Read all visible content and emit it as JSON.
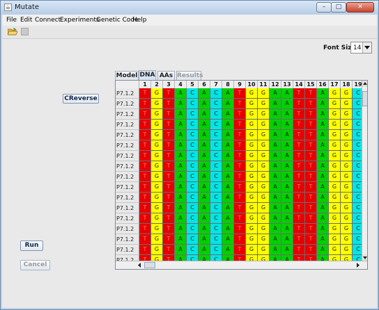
{
  "window": {
    "title": "Mutate",
    "minimize": "–",
    "maximize": "□",
    "close": "✕"
  },
  "menu": [
    "File",
    "Edit",
    "Connect",
    "Experiments",
    "Genetic Code",
    "Help"
  ],
  "toolbar": {
    "open_icon": "folder-open-icon",
    "save_icon": "save-icon"
  },
  "font_size": {
    "label": "Font Size:",
    "value": "14"
  },
  "buttons": {
    "reverse": "CReverse",
    "run": "Run",
    "cancel": "Cancel"
  },
  "tabs": [
    {
      "label": "Model",
      "active": false,
      "enabled": true
    },
    {
      "label": "DNA",
      "active": true,
      "enabled": true
    },
    {
      "label": "AAs",
      "active": false,
      "enabled": true
    },
    {
      "label": "Results",
      "active": false,
      "enabled": false
    }
  ],
  "table": {
    "columns": [
      "1",
      "2",
      "3",
      "4",
      "5",
      "6",
      "7",
      "8",
      "9",
      "10",
      "11",
      "12",
      "13",
      "14",
      "15",
      "16",
      "17",
      "18",
      "19"
    ],
    "sequence": [
      "T",
      "G",
      "T",
      "A",
      "C",
      "A",
      "C",
      "A",
      "T",
      "G",
      "G",
      "A",
      "A",
      "T",
      "T",
      "A",
      "G",
      "G",
      "C"
    ],
    "row_label": "P7.1.2",
    "row_count": 17
  },
  "colors": {
    "G": "#ffff00",
    "A": "#00d000",
    "C": "#00e5e5",
    "T": "#e60000"
  }
}
